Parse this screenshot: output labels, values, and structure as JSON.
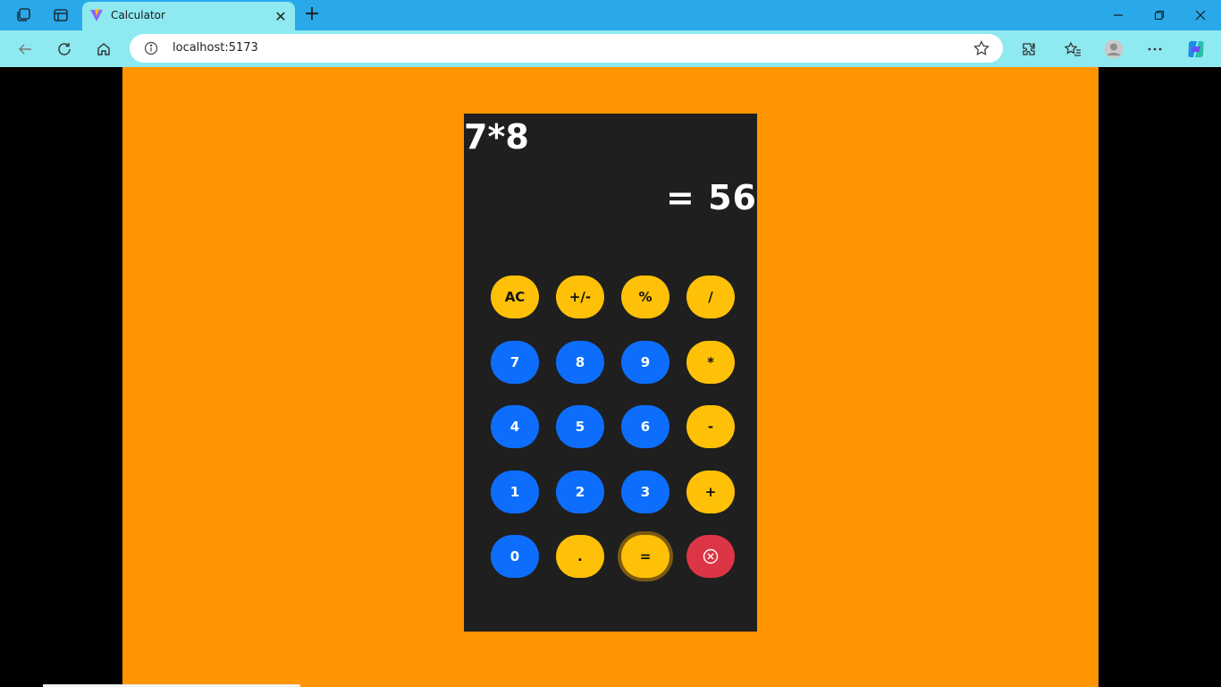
{
  "browser": {
    "tab_title": "Calculator",
    "url": "localhost:5173"
  },
  "calculator": {
    "expression": "7*8",
    "result": "= 56",
    "keys": [
      {
        "label": "AC",
        "kind": "op"
      },
      {
        "label": "+/-",
        "kind": "op"
      },
      {
        "label": "%",
        "kind": "op"
      },
      {
        "label": "/",
        "kind": "op"
      },
      {
        "label": "7",
        "kind": "num"
      },
      {
        "label": "8",
        "kind": "num"
      },
      {
        "label": "9",
        "kind": "num"
      },
      {
        "label": "*",
        "kind": "op"
      },
      {
        "label": "4",
        "kind": "num"
      },
      {
        "label": "5",
        "kind": "num"
      },
      {
        "label": "6",
        "kind": "num"
      },
      {
        "label": "-",
        "kind": "op"
      },
      {
        "label": "1",
        "kind": "num"
      },
      {
        "label": "2",
        "kind": "num"
      },
      {
        "label": "3",
        "kind": "num"
      },
      {
        "label": "+",
        "kind": "op"
      },
      {
        "label": "0",
        "kind": "num"
      },
      {
        "label": ".",
        "kind": "op"
      },
      {
        "label": "=",
        "kind": "op"
      },
      {
        "icon": "circle-x-icon",
        "kind": "del"
      }
    ]
  },
  "colors": {
    "page_background": "#ff9500",
    "calculator_background": "#1f1f1f",
    "operator_key": "#ffc107",
    "number_key": "#0d6efd",
    "delete_key": "#dc3545",
    "tab_bar": "#29a9ea",
    "toolbar": "#8eeaf0"
  }
}
